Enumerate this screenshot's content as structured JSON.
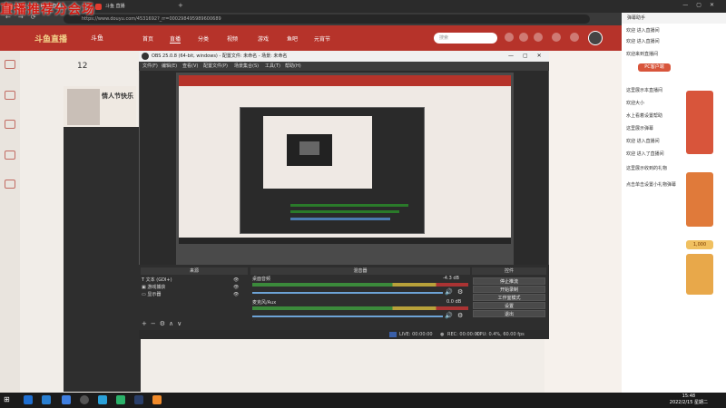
{
  "browser": {
    "tabs": [
      {
        "label": "主播 - 斗鱼 Prog 直播...",
        "active": true
      },
      {
        "label": "斗鱼 直播",
        "active": false
      },
      {
        "label": "",
        "active": false
      }
    ],
    "url": "https://www.douyu.com/4531692?_rr=000298495989600689",
    "colors": {
      "chrome": "#2b2b2b",
      "brand": "#b6332a"
    }
  },
  "overlay_banner": "直播推荐分会场",
  "site": {
    "logo": "斗鱼直播",
    "brand": "斗鱼",
    "nav": [
      "首页",
      "直播",
      "分类",
      "视频",
      "游戏",
      "鱼吧",
      "元宵节"
    ],
    "search_placeholder": "搜索",
    "room_count": "12",
    "streamer_name": "情人节快乐"
  },
  "chat": {
    "title": "弹幕助手",
    "lines": [
      "欢迎 进入直播间",
      "欢迎 进入直播间",
      "欢迎来到直播间",
      "这里展示本直播间",
      "欢迎大小",
      "水上看着设置帮助",
      "这里展示弹幕",
      "欢迎 进入直播间",
      "欢迎 进入了直播间",
      "这里展示收到的礼物",
      "点击单击设置小礼物弹幕"
    ],
    "promos": [
      "PC客户端",
      "1,000"
    ]
  },
  "obs": {
    "title": "OBS 25.0.8 (64-bit, windows) - 配置文件: 未命名 - 场景: 未命名",
    "menu": [
      "文件(F)",
      "编辑(E)",
      "查看(V)",
      "配置文件(P)",
      "场景集合(S)",
      "工具(T)",
      "帮助(H)"
    ],
    "docks": [
      "来源",
      "混音器",
      "控件"
    ],
    "sources": [
      "文本 (GDI+)",
      "游戏捕获",
      "显示器"
    ],
    "mixer": [
      {
        "name": "桌面音频",
        "db": "-4.3 dB"
      },
      {
        "name": "麦克风/Aux",
        "db": "0.0 dB"
      }
    ],
    "controls": [
      "停止推流",
      "开始录制",
      "工作室模式",
      "设置",
      "退出"
    ],
    "status": {
      "live": "LIVE: 00:00:00",
      "rec": "REC: 00:00:00",
      "cpu": "CPU: 0.4%, 60.00 fps"
    }
  },
  "taskbar": {
    "time": "15:48",
    "date": "2022/2/15 星期二"
  }
}
